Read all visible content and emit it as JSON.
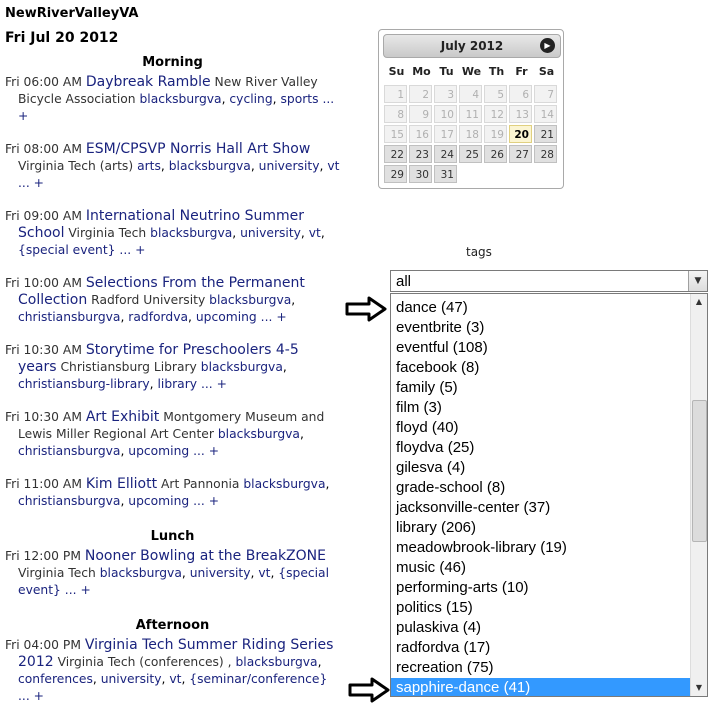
{
  "site_title": "NewRiverValleyVA",
  "date_heading": "Fri Jul 20 2012",
  "sections": [
    {
      "label": "Morning",
      "events": [
        {
          "time": "Fri 06:00 AM",
          "title": "Daybreak Ramble",
          "venue": "New River Valley Bicycle Association",
          "tags": [
            "blacksburgva",
            "cycling",
            "sports"
          ],
          "more": "..."
        },
        {
          "time": "Fri 08:00 AM",
          "title": "ESM/CPSVP Norris Hall Art Show",
          "venue": "Virginia Tech (arts)",
          "tags": [
            "arts",
            "blacksburgva",
            "university",
            "vt"
          ],
          "more": "..."
        },
        {
          "time": "Fri 09:00 AM",
          "title": "International Neutrino Summer School",
          "venue": "Virginia Tech",
          "tags": [
            "blacksburgva",
            "university",
            "vt",
            "{special event}"
          ],
          "more": "..."
        },
        {
          "time": "Fri 10:00 AM",
          "title": "Selections From the Permanent Collection",
          "venue": "Radford University",
          "tags": [
            "blacksburgva",
            "christiansburgva",
            "radfordva",
            "upcoming"
          ],
          "more": "..."
        },
        {
          "time": "Fri 10:30 AM",
          "title": "Storytime for Preschoolers 4-5 years",
          "venue": "Christiansburg Library",
          "tags": [
            "blacksburgva",
            "christiansburg-library",
            "library"
          ],
          "more": "..."
        },
        {
          "time": "Fri 10:30 AM",
          "title": "Art Exhibit",
          "venue": "Montgomery Museum and Lewis Miller Regional Art Center",
          "tags": [
            "blacksburgva",
            "christiansburgva",
            "upcoming"
          ],
          "more": "..."
        },
        {
          "time": "Fri 11:00 AM",
          "title": "Kim Elliott",
          "venue": "Art Pannonia",
          "tags": [
            "blacksburgva",
            "christiansburgva",
            "upcoming"
          ],
          "more": "..."
        }
      ]
    },
    {
      "label": "Lunch",
      "events": [
        {
          "time": "Fri 12:00 PM",
          "title": "Nooner Bowling at the BreakZONE",
          "venue": "Virginia Tech",
          "tags": [
            "blacksburgva",
            "university",
            "vt",
            "{special event}"
          ],
          "more": "..."
        }
      ]
    },
    {
      "label": "Afternoon",
      "events": [
        {
          "time": "Fri 04:00 PM",
          "title": "Virginia Tech Summer Riding Series 2012",
          "venue": "Virginia Tech (conferences) ,",
          "tags": [
            "blacksburgva",
            "conferences",
            "university",
            "vt",
            "{seminar/conference}"
          ],
          "more": "..."
        }
      ]
    }
  ],
  "calendar": {
    "month_label": "July 2012",
    "next_icon": "next-arrow-icon",
    "weekdays": [
      "Su",
      "Mo",
      "Tu",
      "We",
      "Th",
      "Fr",
      "Sa"
    ],
    "weeks": [
      [
        "1",
        "2",
        "3",
        "4",
        "5",
        "6",
        "7"
      ],
      [
        "8",
        "9",
        "10",
        "11",
        "12",
        "13",
        "14"
      ],
      [
        "15",
        "16",
        "17",
        "18",
        "19",
        "20",
        "21"
      ],
      [
        "22",
        "23",
        "24",
        "25",
        "26",
        "27",
        "28"
      ],
      [
        "29",
        "30",
        "31",
        "",
        "",
        "",
        ""
      ]
    ],
    "today": "20",
    "first_active": "21"
  },
  "tags_filter": {
    "label": "tags",
    "selected_value": "all",
    "options": [
      "dance (47)",
      "eventbrite (3)",
      "eventful (108)",
      "facebook (8)",
      "family (5)",
      "film (3)",
      "floyd (40)",
      "floydva (25)",
      "gilesva (4)",
      "grade-school (8)",
      "jacksonville-center (37)",
      "library (206)",
      "meadowbrook-library (19)",
      "music (46)",
      "performing-arts (10)",
      "politics (15)",
      "pulaskiva (4)",
      "radfordva (17)",
      "recreation (75)",
      "sapphire-dance (41)"
    ],
    "highlighted_option": "sapphire-dance (41)"
  }
}
